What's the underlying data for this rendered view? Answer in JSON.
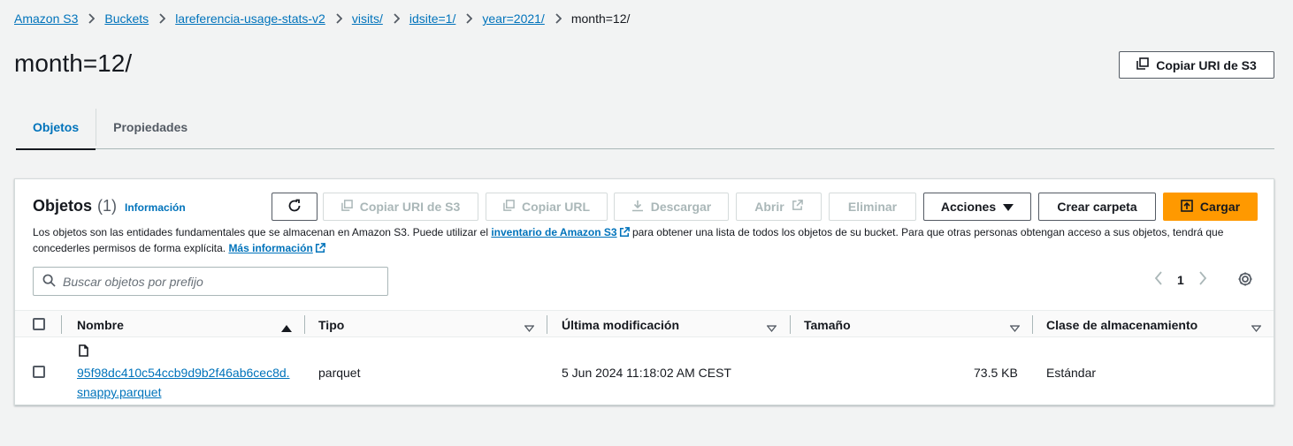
{
  "breadcrumb": {
    "items": [
      "Amazon S3",
      "Buckets",
      "lareferencia-usage-stats-v2",
      "visits/",
      "idsite=1/",
      "year=2021/"
    ],
    "current": "month=12/"
  },
  "page": {
    "title": "month=12/",
    "copy_uri_label": "Copiar URI de S3"
  },
  "tabs": [
    {
      "label": "Objetos",
      "active": true
    },
    {
      "label": "Propiedades",
      "active": false
    }
  ],
  "objects_panel": {
    "title": "Objetos",
    "count": "(1)",
    "info_link": "Información",
    "buttons": {
      "refresh": "refresh",
      "copy_uri": "Copiar URI de S3",
      "copy_url": "Copiar URL",
      "download": "Descargar",
      "open": "Abrir",
      "delete": "Eliminar",
      "actions": "Acciones",
      "create_folder": "Crear carpeta",
      "upload": "Cargar"
    },
    "description_part1": "Los objetos son las entidades fundamentales que se almacenan en Amazon S3. Puede utilizar el ",
    "description_link1": "inventario de Amazon S3",
    "description_part2": " para obtener una lista de todos los objetos de su bucket. Para que otras personas obtengan acceso a sus objetos, tendrá que concederles permisos de forma explícita. ",
    "description_link2": "Más información",
    "search_placeholder": "Buscar objetos por prefijo",
    "pagination": {
      "current_page": "1"
    }
  },
  "table": {
    "columns": [
      "Nombre",
      "Tipo",
      "Última modificación",
      "Tamaño",
      "Clase de almacenamiento"
    ],
    "rows": [
      {
        "name": "95f98dc410c54ccb9d9b2f46ab6cec8d.snappy.parquet",
        "type": "parquet",
        "modified": "5 Jun 2024 11:18:02 AM CEST",
        "size": "73.5 KB",
        "storage_class": "Estándar"
      }
    ]
  },
  "colors": {
    "link": "#0073bb",
    "primary": "#ff9900",
    "text": "#16191f",
    "background": "#f2f3f3"
  }
}
